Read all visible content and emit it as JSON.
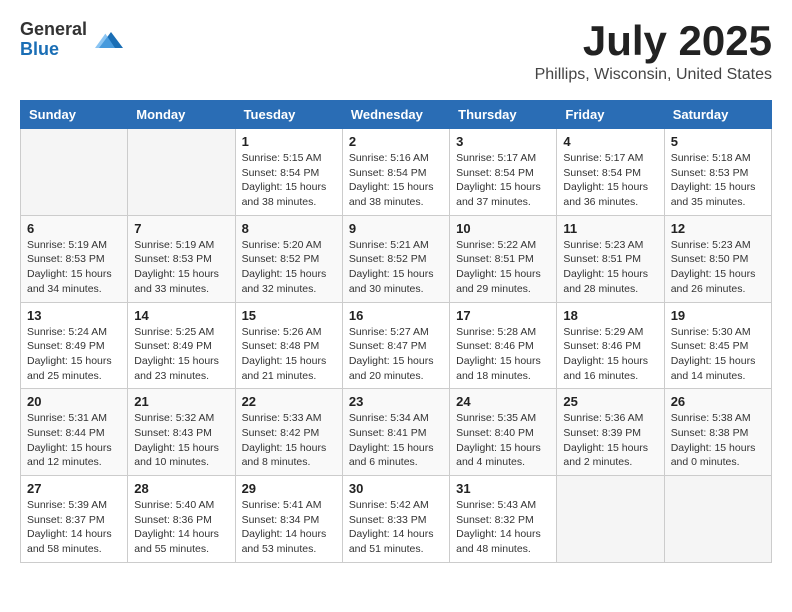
{
  "logo": {
    "general": "General",
    "blue": "Blue"
  },
  "title": "July 2025",
  "location": "Phillips, Wisconsin, United States",
  "days_of_week": [
    "Sunday",
    "Monday",
    "Tuesday",
    "Wednesday",
    "Thursday",
    "Friday",
    "Saturday"
  ],
  "weeks": [
    [
      {
        "day": "",
        "info": ""
      },
      {
        "day": "",
        "info": ""
      },
      {
        "day": "1",
        "sunrise": "Sunrise: 5:15 AM",
        "sunset": "Sunset: 8:54 PM",
        "daylight": "Daylight: 15 hours and 38 minutes."
      },
      {
        "day": "2",
        "sunrise": "Sunrise: 5:16 AM",
        "sunset": "Sunset: 8:54 PM",
        "daylight": "Daylight: 15 hours and 38 minutes."
      },
      {
        "day": "3",
        "sunrise": "Sunrise: 5:17 AM",
        "sunset": "Sunset: 8:54 PM",
        "daylight": "Daylight: 15 hours and 37 minutes."
      },
      {
        "day": "4",
        "sunrise": "Sunrise: 5:17 AM",
        "sunset": "Sunset: 8:54 PM",
        "daylight": "Daylight: 15 hours and 36 minutes."
      },
      {
        "day": "5",
        "sunrise": "Sunrise: 5:18 AM",
        "sunset": "Sunset: 8:53 PM",
        "daylight": "Daylight: 15 hours and 35 minutes."
      }
    ],
    [
      {
        "day": "6",
        "sunrise": "Sunrise: 5:19 AM",
        "sunset": "Sunset: 8:53 PM",
        "daylight": "Daylight: 15 hours and 34 minutes."
      },
      {
        "day": "7",
        "sunrise": "Sunrise: 5:19 AM",
        "sunset": "Sunset: 8:53 PM",
        "daylight": "Daylight: 15 hours and 33 minutes."
      },
      {
        "day": "8",
        "sunrise": "Sunrise: 5:20 AM",
        "sunset": "Sunset: 8:52 PM",
        "daylight": "Daylight: 15 hours and 32 minutes."
      },
      {
        "day": "9",
        "sunrise": "Sunrise: 5:21 AM",
        "sunset": "Sunset: 8:52 PM",
        "daylight": "Daylight: 15 hours and 30 minutes."
      },
      {
        "day": "10",
        "sunrise": "Sunrise: 5:22 AM",
        "sunset": "Sunset: 8:51 PM",
        "daylight": "Daylight: 15 hours and 29 minutes."
      },
      {
        "day": "11",
        "sunrise": "Sunrise: 5:23 AM",
        "sunset": "Sunset: 8:51 PM",
        "daylight": "Daylight: 15 hours and 28 minutes."
      },
      {
        "day": "12",
        "sunrise": "Sunrise: 5:23 AM",
        "sunset": "Sunset: 8:50 PM",
        "daylight": "Daylight: 15 hours and 26 minutes."
      }
    ],
    [
      {
        "day": "13",
        "sunrise": "Sunrise: 5:24 AM",
        "sunset": "Sunset: 8:49 PM",
        "daylight": "Daylight: 15 hours and 25 minutes."
      },
      {
        "day": "14",
        "sunrise": "Sunrise: 5:25 AM",
        "sunset": "Sunset: 8:49 PM",
        "daylight": "Daylight: 15 hours and 23 minutes."
      },
      {
        "day": "15",
        "sunrise": "Sunrise: 5:26 AM",
        "sunset": "Sunset: 8:48 PM",
        "daylight": "Daylight: 15 hours and 21 minutes."
      },
      {
        "day": "16",
        "sunrise": "Sunrise: 5:27 AM",
        "sunset": "Sunset: 8:47 PM",
        "daylight": "Daylight: 15 hours and 20 minutes."
      },
      {
        "day": "17",
        "sunrise": "Sunrise: 5:28 AM",
        "sunset": "Sunset: 8:46 PM",
        "daylight": "Daylight: 15 hours and 18 minutes."
      },
      {
        "day": "18",
        "sunrise": "Sunrise: 5:29 AM",
        "sunset": "Sunset: 8:46 PM",
        "daylight": "Daylight: 15 hours and 16 minutes."
      },
      {
        "day": "19",
        "sunrise": "Sunrise: 5:30 AM",
        "sunset": "Sunset: 8:45 PM",
        "daylight": "Daylight: 15 hours and 14 minutes."
      }
    ],
    [
      {
        "day": "20",
        "sunrise": "Sunrise: 5:31 AM",
        "sunset": "Sunset: 8:44 PM",
        "daylight": "Daylight: 15 hours and 12 minutes."
      },
      {
        "day": "21",
        "sunrise": "Sunrise: 5:32 AM",
        "sunset": "Sunset: 8:43 PM",
        "daylight": "Daylight: 15 hours and 10 minutes."
      },
      {
        "day": "22",
        "sunrise": "Sunrise: 5:33 AM",
        "sunset": "Sunset: 8:42 PM",
        "daylight": "Daylight: 15 hours and 8 minutes."
      },
      {
        "day": "23",
        "sunrise": "Sunrise: 5:34 AM",
        "sunset": "Sunset: 8:41 PM",
        "daylight": "Daylight: 15 hours and 6 minutes."
      },
      {
        "day": "24",
        "sunrise": "Sunrise: 5:35 AM",
        "sunset": "Sunset: 8:40 PM",
        "daylight": "Daylight: 15 hours and 4 minutes."
      },
      {
        "day": "25",
        "sunrise": "Sunrise: 5:36 AM",
        "sunset": "Sunset: 8:39 PM",
        "daylight": "Daylight: 15 hours and 2 minutes."
      },
      {
        "day": "26",
        "sunrise": "Sunrise: 5:38 AM",
        "sunset": "Sunset: 8:38 PM",
        "daylight": "Daylight: 15 hours and 0 minutes."
      }
    ],
    [
      {
        "day": "27",
        "sunrise": "Sunrise: 5:39 AM",
        "sunset": "Sunset: 8:37 PM",
        "daylight": "Daylight: 14 hours and 58 minutes."
      },
      {
        "day": "28",
        "sunrise": "Sunrise: 5:40 AM",
        "sunset": "Sunset: 8:36 PM",
        "daylight": "Daylight: 14 hours and 55 minutes."
      },
      {
        "day": "29",
        "sunrise": "Sunrise: 5:41 AM",
        "sunset": "Sunset: 8:34 PM",
        "daylight": "Daylight: 14 hours and 53 minutes."
      },
      {
        "day": "30",
        "sunrise": "Sunrise: 5:42 AM",
        "sunset": "Sunset: 8:33 PM",
        "daylight": "Daylight: 14 hours and 51 minutes."
      },
      {
        "day": "31",
        "sunrise": "Sunrise: 5:43 AM",
        "sunset": "Sunset: 8:32 PM",
        "daylight": "Daylight: 14 hours and 48 minutes."
      },
      {
        "day": "",
        "info": ""
      },
      {
        "day": "",
        "info": ""
      }
    ]
  ]
}
